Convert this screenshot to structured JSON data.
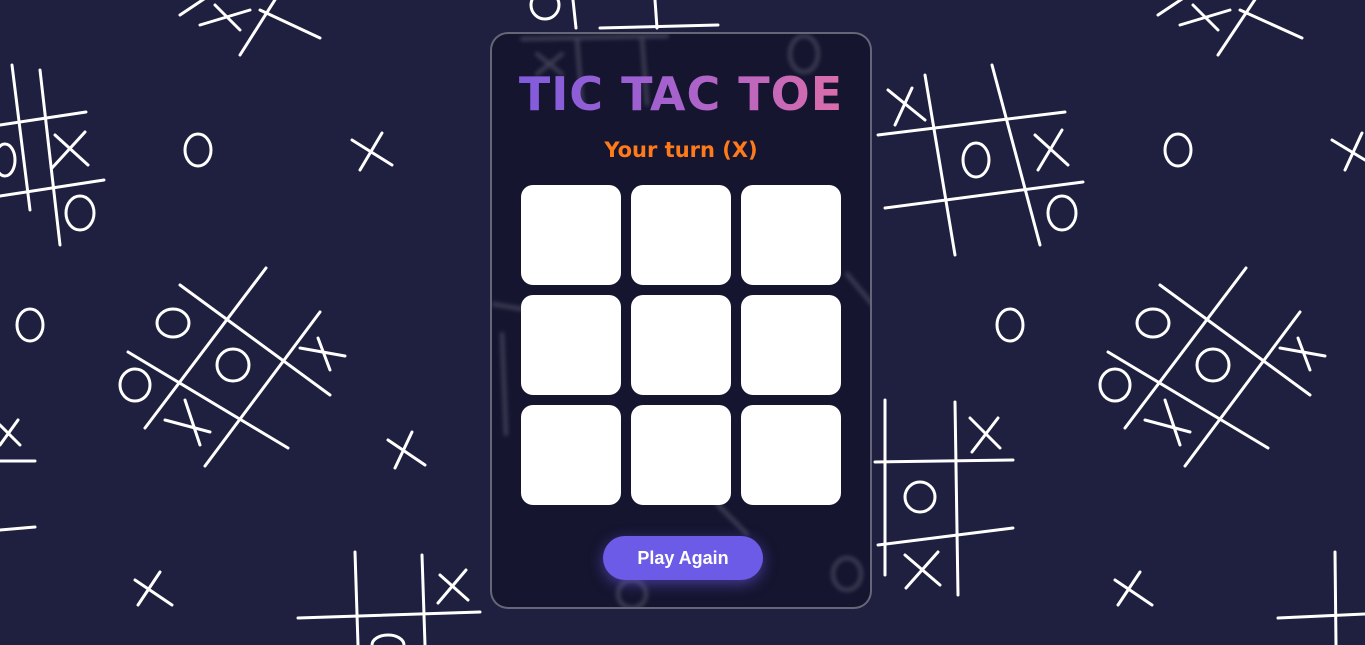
{
  "game": {
    "title": "TIC TAC TOE",
    "status": "Your turn (X)",
    "board": [
      "",
      "",
      "",
      "",
      "",
      "",
      "",
      "",
      ""
    ],
    "play_again_label": "Play Again"
  },
  "colors": {
    "background": "#1f1f3f",
    "title_gradient_start": "#7a5be0",
    "title_gradient_end": "#e46fa4",
    "status": "#ff7a1a",
    "button": "#6c5be6",
    "cell": "#ffffff"
  }
}
